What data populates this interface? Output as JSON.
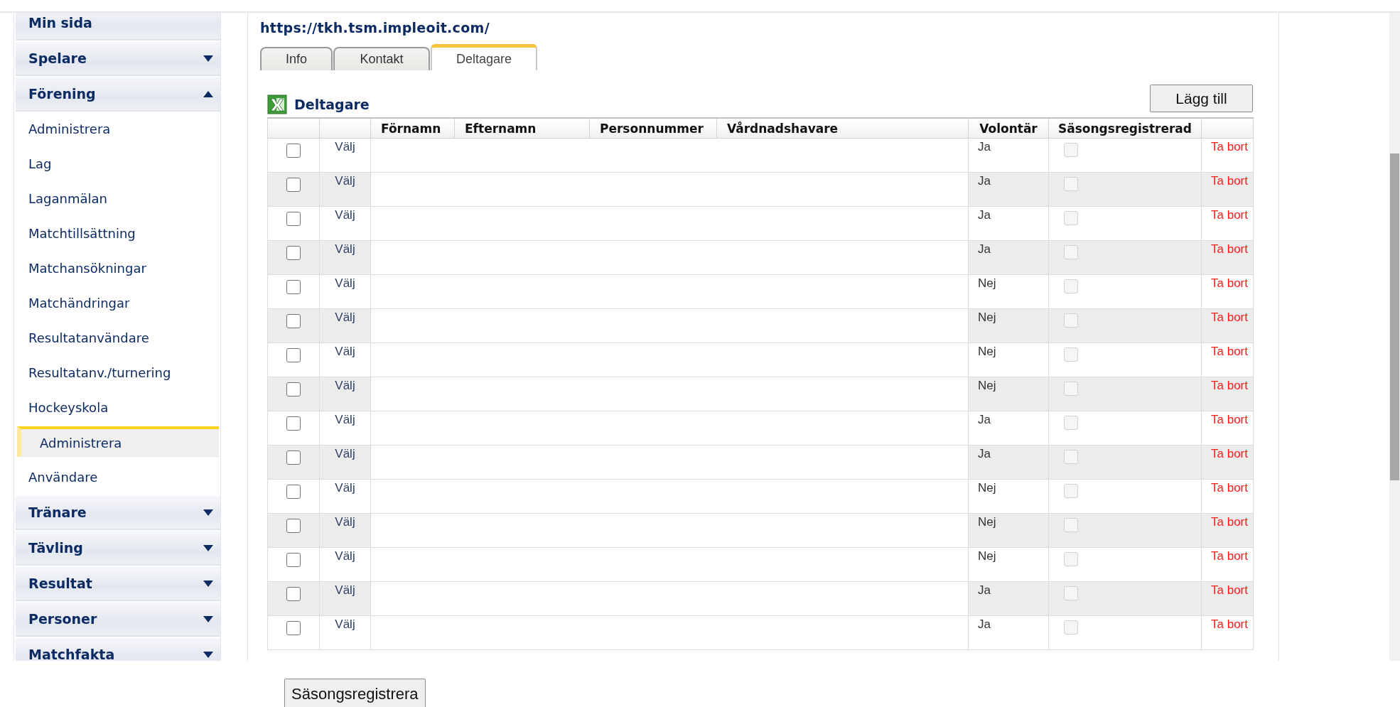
{
  "sidebar": {
    "sections": [
      {
        "label": "Min sida"
      },
      {
        "label": "Spelare",
        "expanded": false
      },
      {
        "label": "Förening",
        "expanded": true,
        "children": [
          {
            "label": "Administrera",
            "selected": false
          },
          {
            "label": "Lag",
            "selected": false
          },
          {
            "label": "Laganmälan",
            "selected": false
          },
          {
            "label": "Matchtillsättning",
            "selected": false
          },
          {
            "label": "Matchansökningar",
            "selected": false
          },
          {
            "label": "Matchändringar",
            "selected": false
          },
          {
            "label": "Resultatanvändare",
            "selected": false
          },
          {
            "label": "Resultatanv./turnering",
            "selected": false
          },
          {
            "label": "Hockeyskola",
            "selected": false,
            "children": [
              {
                "label": "Administrera",
                "selected": true
              }
            ]
          },
          {
            "label": "Användare",
            "selected": false
          }
        ]
      },
      {
        "label": "Tränare",
        "expanded": false
      },
      {
        "label": "Tävling",
        "expanded": false
      },
      {
        "label": "Resultat",
        "expanded": false
      },
      {
        "label": "Personer",
        "expanded": false
      },
      {
        "label": "Matchfakta",
        "expanded": false
      }
    ]
  },
  "url": "https://tkh.tsm.impleoit.com/",
  "tabs": [
    {
      "label": "Info",
      "selected": false
    },
    {
      "label": "Kontakt",
      "selected": false
    },
    {
      "label": "Deltagare",
      "selected": true
    }
  ],
  "section_title": "Deltagare",
  "add_button": "Lägg till",
  "table": {
    "columns": [
      "",
      "",
      "Förnamn",
      "Efternamn",
      "Personnummer",
      "Vårdnadshavare",
      "Volontär",
      "Säsongsregistrerad",
      ""
    ],
    "rows": [
      {
        "checked": false,
        "select": "Välj",
        "volunteer": "Ja",
        "season_registered": false,
        "delete": "Ta bort"
      },
      {
        "checked": false,
        "select": "Välj",
        "volunteer": "Ja",
        "season_registered": false,
        "delete": "Ta bort"
      },
      {
        "checked": false,
        "select": "Välj",
        "volunteer": "Ja",
        "season_registered": false,
        "delete": "Ta bort"
      },
      {
        "checked": false,
        "select": "Välj",
        "volunteer": "Ja",
        "season_registered": false,
        "delete": "Ta bort"
      },
      {
        "checked": false,
        "select": "Välj",
        "volunteer": "Nej",
        "season_registered": false,
        "delete": "Ta bort"
      },
      {
        "checked": false,
        "select": "Välj",
        "volunteer": "Nej",
        "season_registered": false,
        "delete": "Ta bort"
      },
      {
        "checked": false,
        "select": "Välj",
        "volunteer": "Nej",
        "season_registered": false,
        "delete": "Ta bort"
      },
      {
        "checked": false,
        "select": "Välj",
        "volunteer": "Nej",
        "season_registered": false,
        "delete": "Ta bort"
      },
      {
        "checked": false,
        "select": "Välj",
        "volunteer": "Ja",
        "season_registered": false,
        "delete": "Ta bort"
      },
      {
        "checked": false,
        "select": "Välj",
        "volunteer": "Ja",
        "season_registered": false,
        "delete": "Ta bort"
      },
      {
        "checked": false,
        "select": "Välj",
        "volunteer": "Nej",
        "season_registered": false,
        "delete": "Ta bort"
      },
      {
        "checked": false,
        "select": "Välj",
        "volunteer": "Nej",
        "season_registered": false,
        "delete": "Ta bort"
      },
      {
        "checked": false,
        "select": "Välj",
        "volunteer": "Nej",
        "season_registered": false,
        "delete": "Ta bort"
      },
      {
        "checked": false,
        "select": "Välj",
        "volunteer": "Ja",
        "season_registered": false,
        "delete": "Ta bort"
      },
      {
        "checked": false,
        "select": "Välj",
        "volunteer": "Ja",
        "season_registered": false,
        "delete": "Ta bort"
      }
    ]
  },
  "season_register_button": "Säsongsregistrera"
}
